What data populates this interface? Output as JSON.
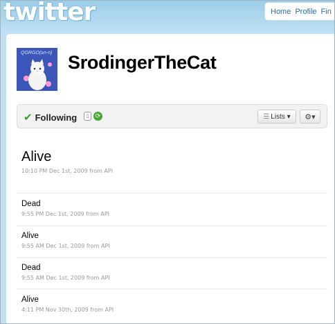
{
  "header": {
    "logo": "twitter",
    "nav": [
      "Home",
      "Profile",
      "Fin"
    ]
  },
  "profile": {
    "screen_name": "SrodingerTheCat",
    "avatar_caption": "QGRGO(≥n-n)"
  },
  "follow_bar": {
    "status": "Following",
    "lists_label": "Lists ▾",
    "gear_label": "⚙▾"
  },
  "tweets": [
    {
      "text": "Alive",
      "meta": "10:10 PM Dec 1st, 2009 from API"
    },
    {
      "text": "Dead",
      "meta": "9:55 PM Dec 1st, 2009 from API"
    },
    {
      "text": "Alive",
      "meta": "9:55 AM Dec 1st, 2009 from API"
    },
    {
      "text": "Dead",
      "meta": "9:55 AM Dec 1st, 2009 from API"
    },
    {
      "text": "Alive",
      "meta": "4:11 PM Nov 30th, 2009 from API"
    }
  ]
}
